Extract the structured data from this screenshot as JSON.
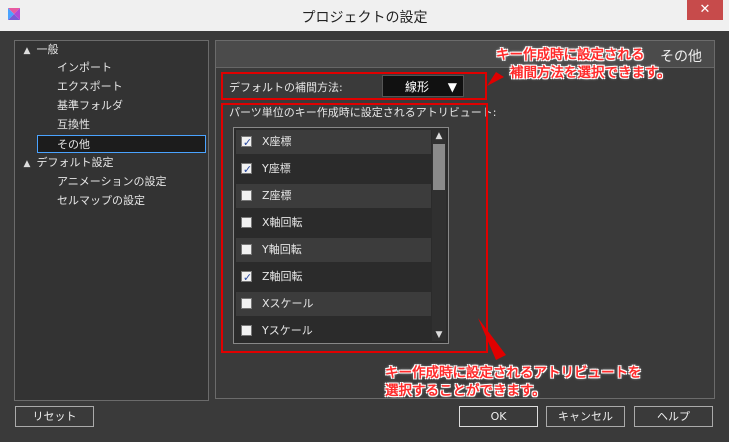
{
  "window": {
    "title": "プロジェクトの設定",
    "close_label": "✕"
  },
  "tree": {
    "items": [
      {
        "label": "一般",
        "expanded": true
      },
      {
        "label": "インポート"
      },
      {
        "label": "エクスポート"
      },
      {
        "label": "基準フォルダ"
      },
      {
        "label": "互換性"
      },
      {
        "label": "その他",
        "selected": true
      },
      {
        "label": "デフォルト設定",
        "expanded": true
      },
      {
        "label": "アニメーションの設定"
      },
      {
        "label": "セルマップの設定"
      }
    ],
    "expand_icon": "▲"
  },
  "panel": {
    "title": "その他",
    "interpolation_label": "デフォルトの補間方法:",
    "interpolation_value": "線形",
    "interpolation_arrow": "▼",
    "attributes_label": "パーツ単位のキー作成時に設定されるアトリビュート:",
    "attributes": [
      {
        "label": "X座標",
        "checked": true
      },
      {
        "label": "Y座標",
        "checked": true
      },
      {
        "label": "Z座標",
        "checked": false
      },
      {
        "label": "X軸回転",
        "checked": false
      },
      {
        "label": "Y軸回転",
        "checked": false
      },
      {
        "label": "Z軸回転",
        "checked": true
      },
      {
        "label": "Xスケール",
        "checked": false
      },
      {
        "label": "Yスケール",
        "checked": false
      }
    ],
    "check_mark": "✓",
    "scroll_up": "▲",
    "scroll_down": "▼"
  },
  "annotations": {
    "callout1_line1": "キー作成時に設定される",
    "callout1_line2": "補間方法を選択できます。",
    "callout2_line1": "キー作成時に設定されるアトリビュートを",
    "callout2_line2": "選択することができます。",
    "color": "#e00000"
  },
  "buttons": {
    "reset": "リセット",
    "ok": "OK",
    "cancel": "キャンセル",
    "help": "ヘルプ"
  }
}
